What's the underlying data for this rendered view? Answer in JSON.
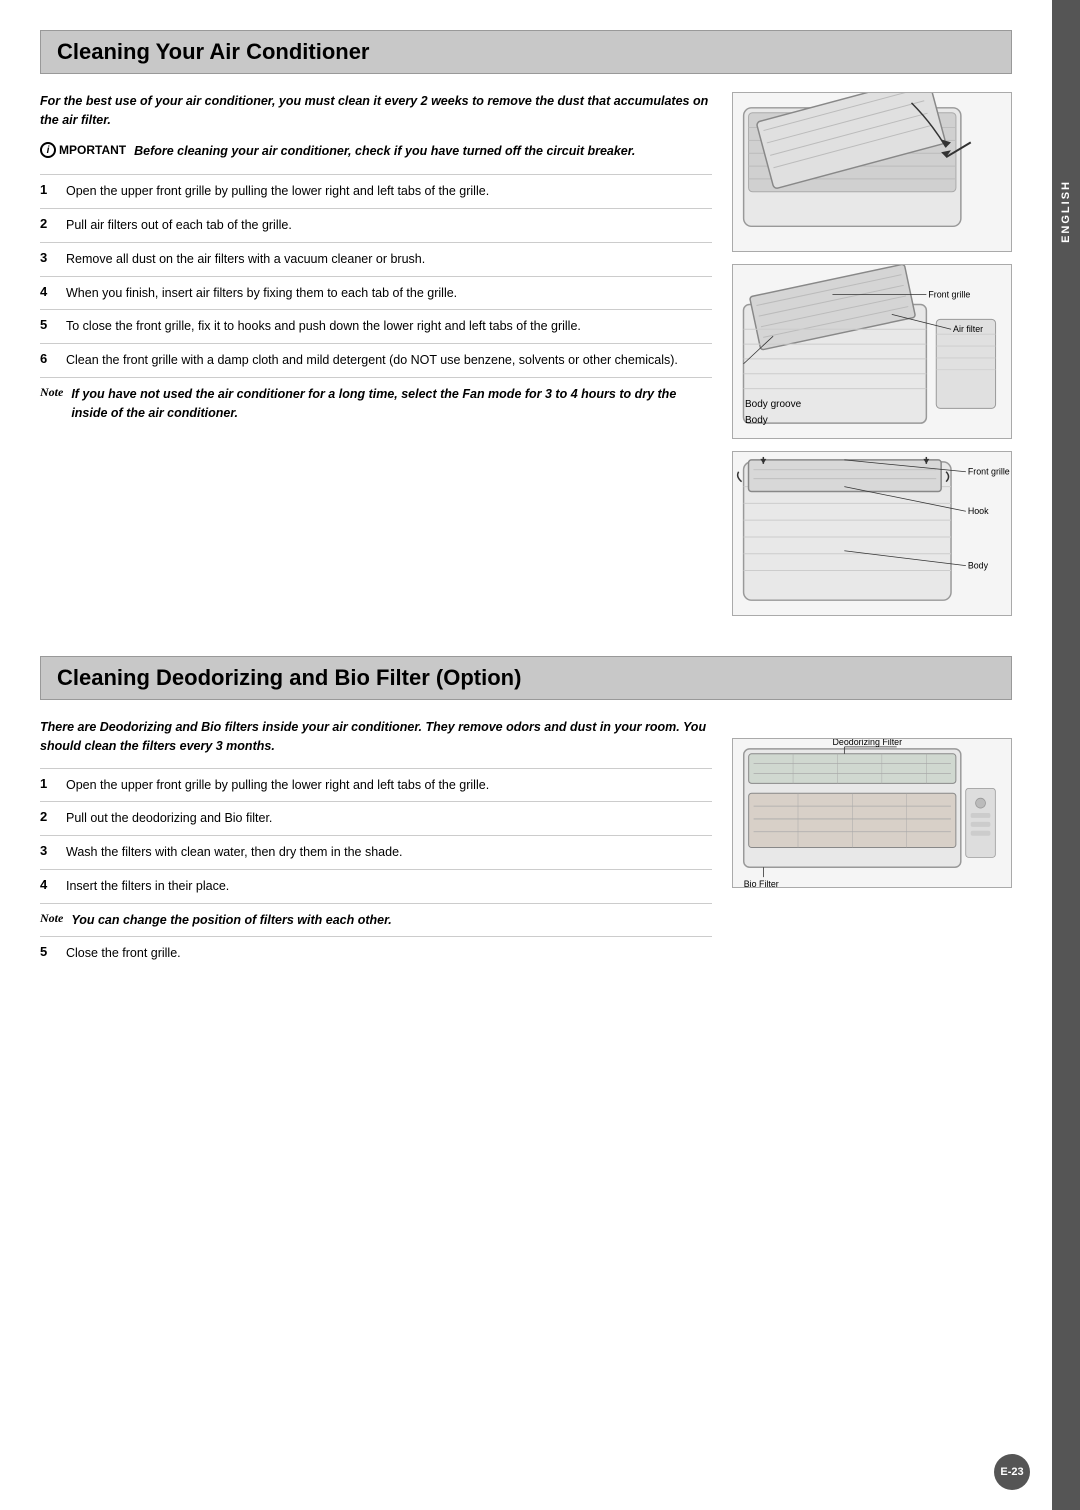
{
  "sidebar": {
    "lang": "ENGLISH"
  },
  "page_number": "E-23",
  "section1": {
    "title": "Cleaning Your Air Conditioner",
    "intro": "For the best use of your air conditioner, you must clean it every 2 weeks to remove the dust that accumulates on the air filter.",
    "important_label": "PORTANT",
    "important_text": "Before cleaning your air conditioner, check if you have turned off the circuit breaker.",
    "steps": [
      {
        "num": "1",
        "text": "Open the upper front grille by pulling the lower right and left tabs of the grille."
      },
      {
        "num": "2",
        "text": "Pull air filters out of each tab of the grille."
      },
      {
        "num": "3",
        "text": "Remove all dust on the air filters with a vacuum cleaner or brush."
      },
      {
        "num": "4",
        "text": "When you finish, insert air filters by fixing them to each tab of the grille."
      },
      {
        "num": "5",
        "text": "To close the front grille, fix it to hooks and push down the lower right and left tabs of the grille."
      },
      {
        "num": "6",
        "text": "Clean the front grille with a damp cloth and mild detergent (do NOT use benzene, solvents or other chemicals)."
      }
    ],
    "note_label": "Note",
    "note_text": "If you have not used the air conditioner for a long time, select the Fan mode for 3 to 4 hours to dry the inside of the air conditioner.",
    "diagram_top_labels": {
      "front_grille": "Front grille",
      "air_filter": "Air filter",
      "body_groove": "Body groove",
      "body": "Body"
    },
    "diagram_bottom_labels": {
      "front_grille": "Front grille",
      "hook": "Hook",
      "body": "Body"
    }
  },
  "section2": {
    "title": "Cleaning Deodorizing and Bio Filter (Option)",
    "intro": "There are Deodorizing and Bio filters inside your air conditioner. They remove odors and dust in your room. You should clean the filters every 3 months.",
    "steps": [
      {
        "num": "1",
        "text": "Open the upper front grille by pulling the lower right and left tabs of the grille."
      },
      {
        "num": "2",
        "text": "Pull out the deodorizing and Bio filter."
      },
      {
        "num": "3",
        "text": "Wash the filters with clean water, then dry them in the shade."
      },
      {
        "num": "4",
        "text": "Insert the filters in their place."
      },
      {
        "num": "5",
        "text": "Close the front grille."
      }
    ],
    "note_label": "Note",
    "note_text": "You can change the position of filters with each other.",
    "diagram_labels": {
      "deodorizing_filter": "Deodorizing Filter",
      "bio_filter": "Bio Filter"
    }
  }
}
